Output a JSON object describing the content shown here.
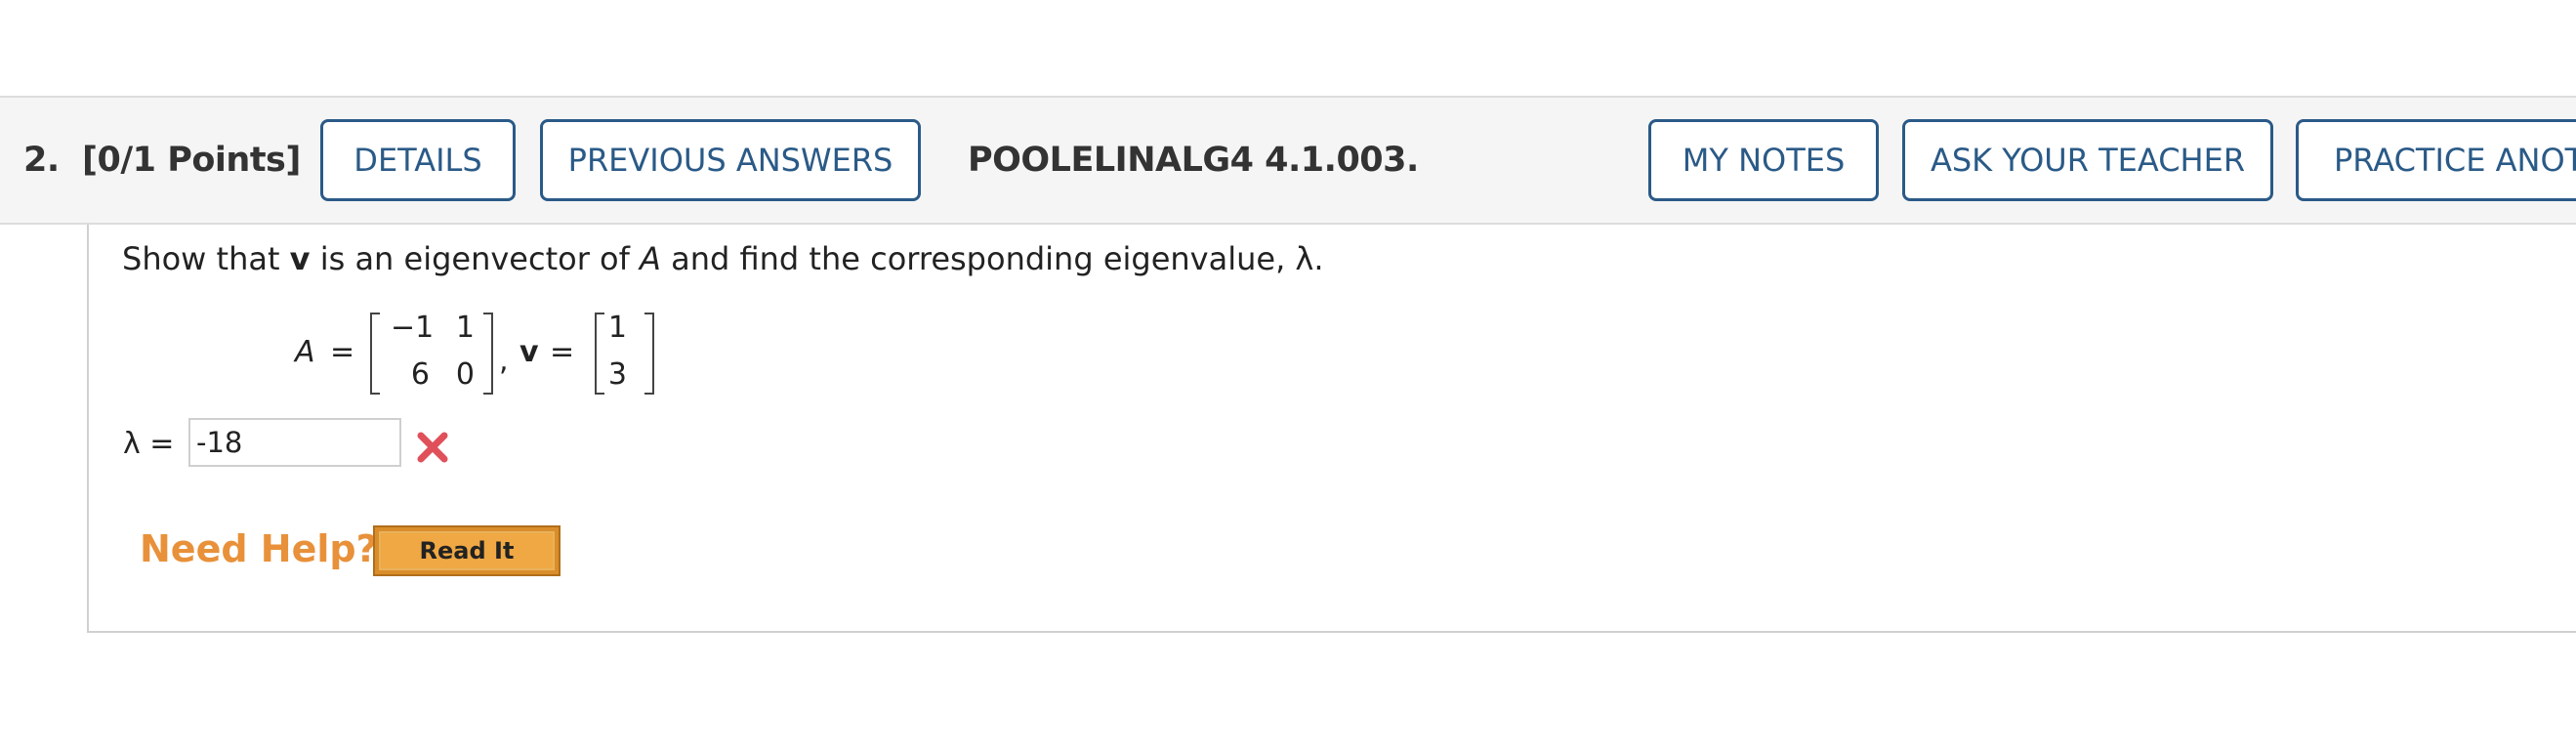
{
  "header": {
    "question_number": "2.",
    "points": "[0/1 Points]",
    "details_label": "DETAILS",
    "previous_answers_label": "PREVIOUS ANSWERS",
    "problem_code": "POOLELINALG4 4.1.003.",
    "my_notes_label": "MY NOTES",
    "ask_teacher_label": "ASK YOUR TEACHER",
    "practice_label": "PRACTICE ANOTHER"
  },
  "question": {
    "text_prefix": "Show that ",
    "v_symbol": "v",
    "text_middle": " is an eigenvector of ",
    "a_symbol": "A",
    "text_suffix": " and find the corresponding eigenvalue, λ."
  },
  "matrices": {
    "a_label": "A",
    "equals": "=",
    "a_row1": [
      "−1",
      "1"
    ],
    "a_row2": [
      "6",
      "0"
    ],
    "comma": ",",
    "v_label": "v",
    "v_col": [
      "1",
      "3"
    ]
  },
  "answer": {
    "label": "λ =",
    "value": "-18",
    "status_icon": "x-mark-icon",
    "status_color": "#e0505a"
  },
  "help": {
    "need_help_label": "Need Help?",
    "read_it_label": "Read It",
    "accent_color": "#e8913a"
  }
}
